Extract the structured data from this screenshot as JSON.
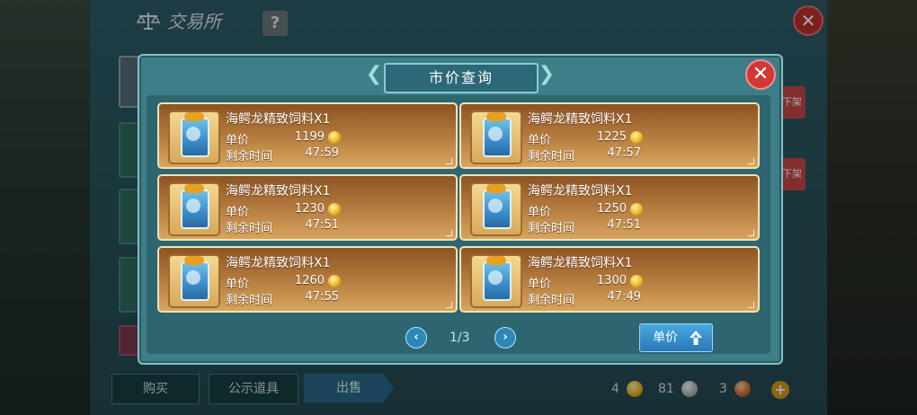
{
  "exchange": {
    "title": "交易所",
    "help_label": "?",
    "close_label": "✕",
    "side_tab_label": "下架",
    "bottom_buttons": [
      "购买",
      "公示道具",
      "出售"
    ],
    "currencies": [
      {
        "amount": "4",
        "type": "gold"
      },
      {
        "amount": "81",
        "type": "silver"
      },
      {
        "amount": "3",
        "type": "copper"
      }
    ],
    "add_label": "+"
  },
  "modal": {
    "title": "市价查询",
    "close_label": "✕",
    "unit_price_label": "单价",
    "remaining_time_label": "剩余时间",
    "listings": [
      {
        "name": "海鳄龙精致饲料X1",
        "price": "1199",
        "time": "47:59"
      },
      {
        "name": "海鳄龙精致饲料X1",
        "price": "1225",
        "time": "47:57"
      },
      {
        "name": "海鳄龙精致饲料X1",
        "price": "1230",
        "time": "47:51"
      },
      {
        "name": "海鳄龙精致饲料X1",
        "price": "1250",
        "time": "47:51"
      },
      {
        "name": "海鳄龙精致饲料X1",
        "price": "1260",
        "time": "47:55"
      },
      {
        "name": "海鳄龙精致饲料X1",
        "price": "1300",
        "time": "47:49"
      }
    ],
    "pager": {
      "text": "1/3",
      "prev": "‹",
      "next": "›"
    },
    "sort_button_label": "单价"
  }
}
